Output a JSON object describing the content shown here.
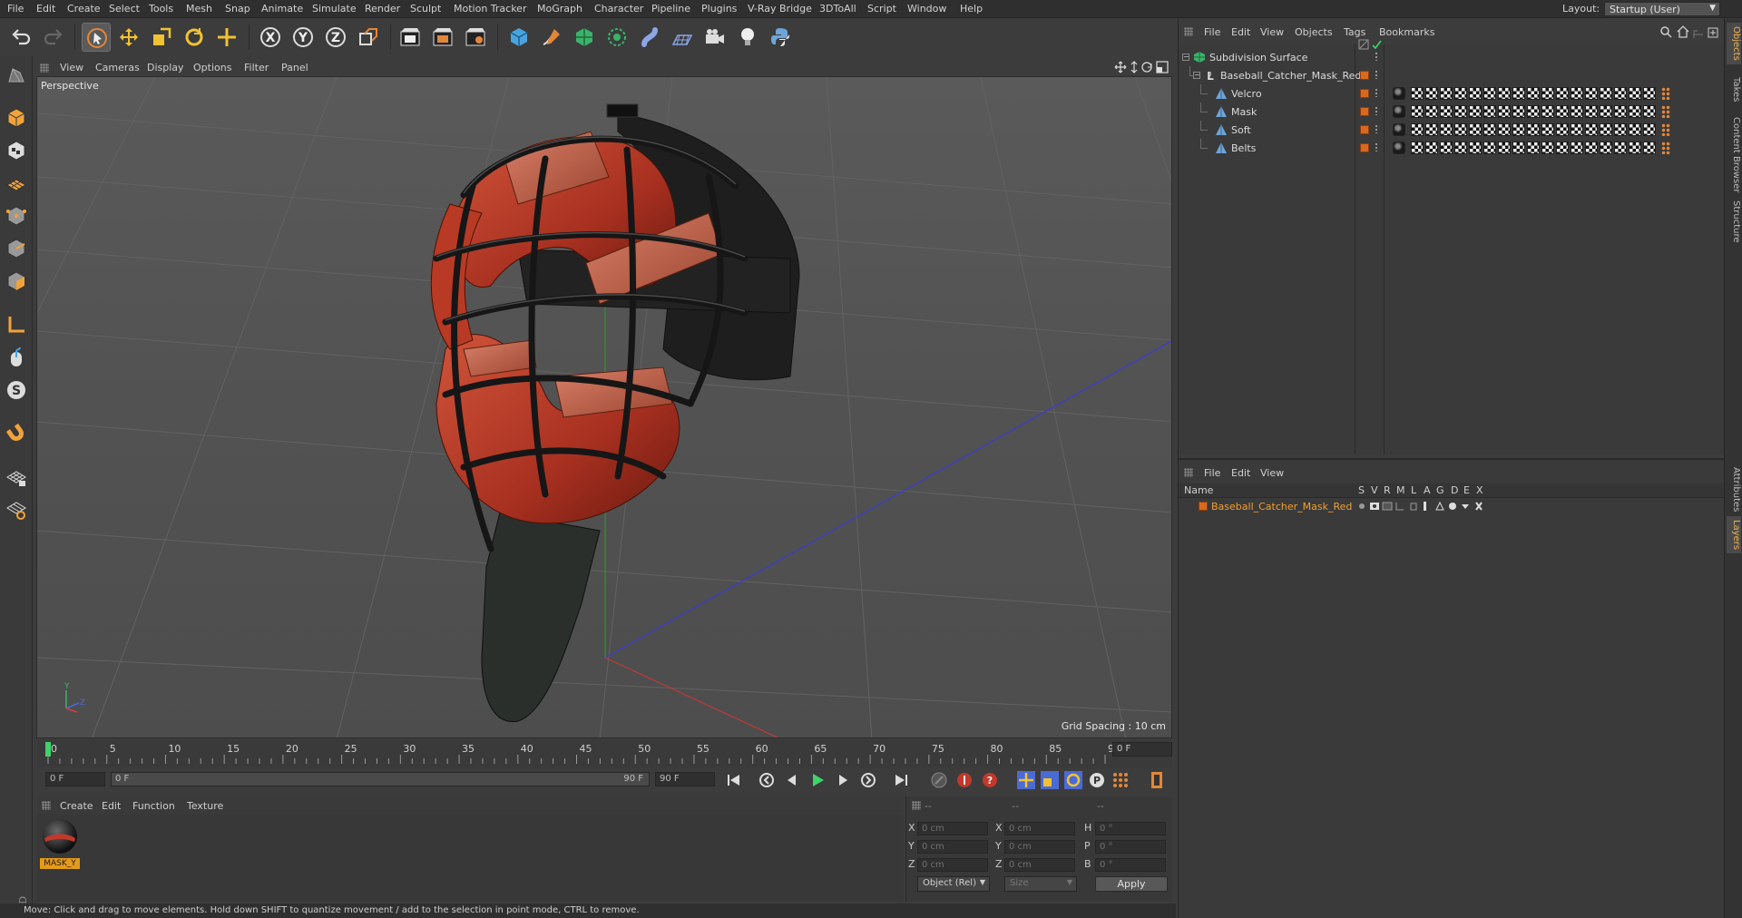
{
  "menubar": {
    "items": [
      "File",
      "Edit",
      "Create",
      "Select",
      "Tools",
      "Mesh",
      "Snap",
      "Animate",
      "Simulate",
      "Render",
      "Sculpt",
      "Motion Tracker",
      "MoGraph",
      "Character",
      "Pipeline",
      "Plugins",
      "V-Ray Bridge",
      "3DToAll",
      "Script",
      "Window",
      "Help"
    ],
    "layout_label": "Layout:",
    "layout_value": "Startup (User)"
  },
  "toolbar": {
    "icons": [
      "undo-icon",
      "redo-icon",
      "select-arrow-icon",
      "move-icon",
      "scale-icon",
      "rotate-icon",
      "recent-tool-icon",
      "x-axis-icon",
      "y-axis-icon",
      "z-axis-icon",
      "coordinate-system-icon",
      "render-view-icon",
      "render-picture-viewer-icon",
      "edit-render-settings-icon",
      "cube-icon",
      "pen-spline-icon",
      "subdivision-icon",
      "array-icon",
      "deformer-icon",
      "floor-icon",
      "camera-icon",
      "light-icon",
      "python-icon"
    ],
    "axis_labels": [
      "X",
      "Y",
      "Z"
    ]
  },
  "viewport": {
    "menu": [
      "View",
      "Cameras",
      "Display",
      "Options",
      "Filter",
      "Panel"
    ],
    "label": "Perspective",
    "grid_spacing": "Grid Spacing : 10 cm",
    "axis_labels": {
      "y": "Y",
      "z": "Z"
    }
  },
  "timeline": {
    "ticks": [
      0,
      5,
      10,
      15,
      20,
      25,
      30,
      35,
      40,
      45,
      50,
      55,
      60,
      65,
      70,
      75,
      80,
      85,
      90
    ],
    "current_frame": "0 F"
  },
  "transport": {
    "start_field": "0 F",
    "slider_left": "0 F",
    "slider_right": "90 F",
    "end_field": "90 F"
  },
  "material_manager": {
    "menu": [
      "Create",
      "Edit",
      "Function",
      "Texture"
    ],
    "materials": [
      {
        "label": "MASK_Y"
      }
    ]
  },
  "coordinates": {
    "headers": [
      "--",
      "--",
      "--"
    ],
    "rows": [
      {
        "a_label": "X",
        "a_value": "0 cm",
        "b_label": "X",
        "b_value": "0 cm",
        "c_label": "H",
        "c_value": "0 °"
      },
      {
        "a_label": "Y",
        "a_value": "0 cm",
        "b_label": "Y",
        "b_value": "0 cm",
        "c_label": "P",
        "c_value": "0 °"
      },
      {
        "a_label": "Z",
        "a_value": "0 cm",
        "b_label": "Z",
        "b_value": "0 cm",
        "c_label": "B",
        "c_value": "0 °"
      }
    ],
    "mode_dropdown": "Object (Rel)",
    "size_dropdown": "Size",
    "apply": "Apply"
  },
  "status": "Move: Click and drag to move elements. Hold down SHIFT to quantize movement / add to the selection in point mode, CTRL to remove.",
  "object_manager": {
    "menu": [
      "File",
      "Edit",
      "View",
      "Objects",
      "Tags",
      "Bookmarks"
    ],
    "objects": [
      {
        "name": "Subdivision Surface",
        "indent": 0,
        "icon": "subdivision-icon",
        "tags": 0
      },
      {
        "name": "Baseball_Catcher_Mask_Red",
        "indent": 1,
        "icon": "null-icon",
        "tags": 0
      },
      {
        "name": "Velcro",
        "indent": 2,
        "icon": "polygon-icon",
        "tags": 17
      },
      {
        "name": "Mask",
        "indent": 2,
        "icon": "polygon-icon",
        "tags": 17
      },
      {
        "name": "Soft",
        "indent": 2,
        "icon": "polygon-icon",
        "tags": 17
      },
      {
        "name": "Belts",
        "indent": 2,
        "icon": "polygon-icon",
        "tags": 17
      }
    ]
  },
  "layer_manager": {
    "menu": [
      "File",
      "Edit",
      "View"
    ],
    "headers": [
      "Name",
      "S",
      "V",
      "R",
      "M",
      "L",
      "A",
      "G",
      "D",
      "E",
      "X"
    ],
    "layers": [
      {
        "name": "Baseball_Catcher_Mask_Red",
        "color": "#d9691f"
      }
    ]
  },
  "side_tabs": [
    "Objects",
    "Takes",
    "Content Browser",
    "Structure",
    "Attributes",
    "Layers"
  ],
  "colors": {
    "accent": "#e59a1a",
    "layer_orange": "#d9691f",
    "active_tab": "#f0b450"
  }
}
